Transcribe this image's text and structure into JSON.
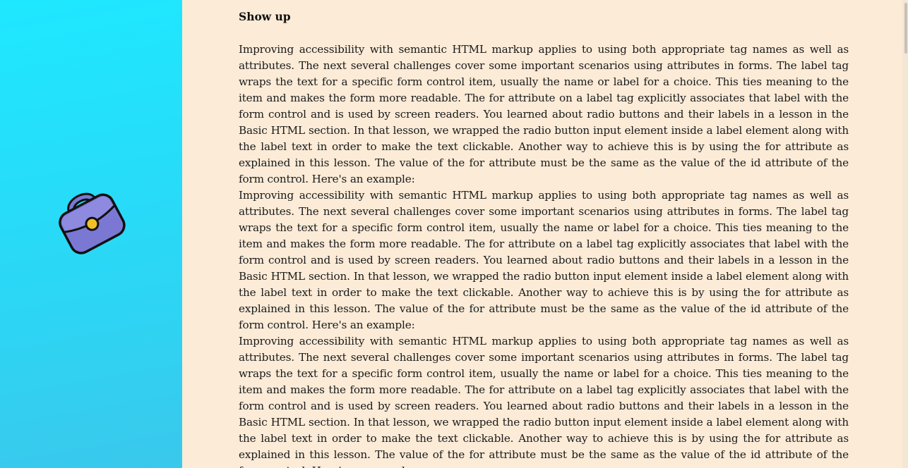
{
  "sidebar": {
    "icon": "briefcase-icon",
    "colors": {
      "gradient_start": "#1ee8ff",
      "gradient_end": "#3ac8ec",
      "bag_body": "#7b78d4",
      "bag_clasp": "#f2c022",
      "outline": "#111111"
    }
  },
  "main": {
    "background": "#fbebd7",
    "title": "Show up",
    "paragraphs": [
      "Improving accessibility with semantic HTML markup applies to using both appropriate tag names as well as attributes. The next several challenges cover some important scenarios using attributes in forms. The label tag wraps the text for a specific form control item, usually the name or label for a choice. This ties meaning to the item and makes the form more readable. The for attribute on a label tag explicitly associates that label with the form control and is used by screen readers. You learned about radio buttons and their labels in a lesson in the Basic HTML section. In that lesson, we wrapped the radio button input element inside a label element along with the label text in order to make the text clickable. Another way to achieve this is by using the for attribute as explained in this lesson. The value of the for attribute must be the same as the value of the id attribute of the form control. Here's an example:",
      "Improving accessibility with semantic HTML markup applies to using both appropriate tag names as well as attributes. The next several challenges cover some important scenarios using attributes in forms. The label tag wraps the text for a specific form control item, usually the name or label for a choice. This ties meaning to the item and makes the form more readable. The for attribute on a label tag explicitly associates that label with the form control and is used by screen readers. You learned about radio buttons and their labels in a lesson in the Basic HTML section. In that lesson, we wrapped the radio button input element inside a label element along with the label text in order to make the text clickable. Another way to achieve this is by using the for attribute as explained in this lesson. The value of the for attribute must be the same as the value of the id attribute of the form control. Here's an example:",
      "Improving accessibility with semantic HTML markup applies to using both appropriate tag names as well as attributes. The next several challenges cover some important scenarios using attributes in forms. The label tag wraps the text for a specific form control item, usually the name or label for a choice. This ties meaning to the item and makes the form more readable. The for attribute on a label tag explicitly associates that label with the form control and is used by screen readers. You learned about radio buttons and their labels in a lesson in the Basic HTML section. In that lesson, we wrapped the radio button input element inside a label element along with the label text in order to make the text clickable. Another way to achieve this is by using the for attribute as explained in this lesson. The value of the for attribute must be the same as the value of the id attribute of the form control. Here's an example:"
    ]
  }
}
